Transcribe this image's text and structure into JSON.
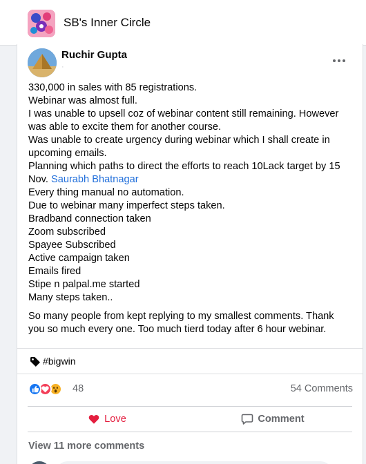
{
  "group": {
    "name": "SB's Inner Circle"
  },
  "post": {
    "author": "Ruchir Gupta",
    "author_sub": "·",
    "more_icon": "more-horizontal-icon",
    "paragraph1": [
      "330,000 in sales with 85 registrations.",
      "Webinar was almost full.",
      "I was unable to upsell coz of webinar content still remaining.  However",
      "was able to excite them for another course.",
      "Was unable to create urgency during webinar which I shall create in",
      "upcoming emails.",
      "Planning which paths to direct the efforts to reach 10Lack target by 15"
    ],
    "mention_prefix": "Nov. ",
    "mention": "Saurabh Bhatnagar",
    "paragraph1_rest": [
      "Every thing manual no automation.",
      "Due to webinar many imperfect steps taken.",
      "Bradband connection taken",
      "Zoom subscribed",
      "Spayee Subscribed",
      "Active campaign taken",
      "Emails fired",
      "Stipe n palpal.me started",
      "Many steps taken.."
    ],
    "paragraph2": [
      "So many people from kept replying to my smallest comments. Thank",
      "you so much every one. Too much tierd today after 6 hour webinar."
    ],
    "hashtag": "#bigwin",
    "reactions": {
      "icons": [
        "like-reaction-icon",
        "love-reaction-icon",
        "wow-reaction-icon"
      ],
      "count": "48"
    },
    "comments_count": "54 Comments",
    "actions": {
      "love_label": "Love",
      "comment_label": "Comment"
    },
    "view_more": "View 11 more comments"
  },
  "colors": {
    "love_red": "#e41e3f",
    "link_blue": "#216fdb",
    "muted": "#65676b",
    "like_blue": "#1877f2",
    "wow_yellow": "#f7b125"
  }
}
